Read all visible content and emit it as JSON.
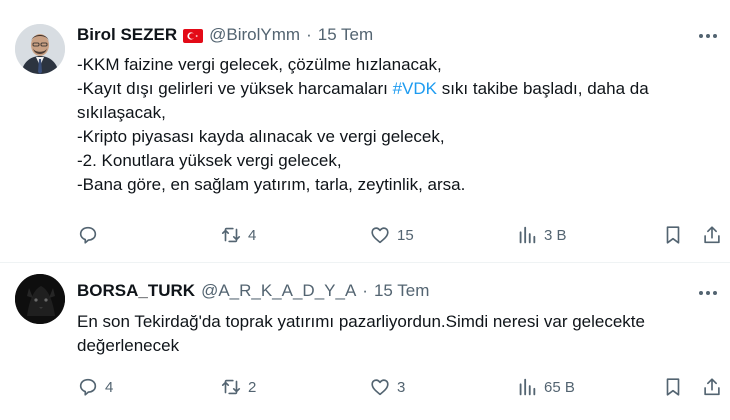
{
  "tweets": [
    {
      "name": "Birol SEZER",
      "handle": "@BirolYmm",
      "date": "15 Tem",
      "separator": "·",
      "lines": [
        "-KKM faizine vergi gelecek, çözülme hızlanacak,",
        "-Kayıt dışı gelirleri ve yüksek harcamaları ",
        "#VDK",
        " sıkı takibe başladı, daha da",
        "sıkılaşacak,",
        "-Kripto piyasası kayda alınacak ve vergi gelecek,",
        "-2. Konutlara yüksek vergi gelecek,",
        "-Bana göre, en sağlam yatırım, tarla, zeytinlik, arsa."
      ],
      "replies": "",
      "retweets": "4",
      "likes": "15",
      "views": "3 B"
    },
    {
      "name": "BORSA_TURK",
      "handle": "@A_R_K_A_D_Y_A",
      "date": "15 Tem",
      "separator": "·",
      "lines": [
        "En son Tekirdağ'da toprak yatırımı pazarliyordun.Simdi neresi var gelecekte",
        "değerlenecek"
      ],
      "replies": "4",
      "retweets": "2",
      "likes": "3",
      "views": "65 B"
    }
  ],
  "icons": {
    "flag": "turkey-flag-icon",
    "more": "more-dots-icon",
    "reply": "reply-icon",
    "retweet": "retweet-icon",
    "like": "heart-icon",
    "views": "views-bar-chart-icon",
    "bookmark": "bookmark-icon",
    "share": "share-icon"
  },
  "colors": {
    "text": "#0f1419",
    "muted": "#536471",
    "link": "#1d9bf0",
    "flag_red": "#e30a17"
  }
}
